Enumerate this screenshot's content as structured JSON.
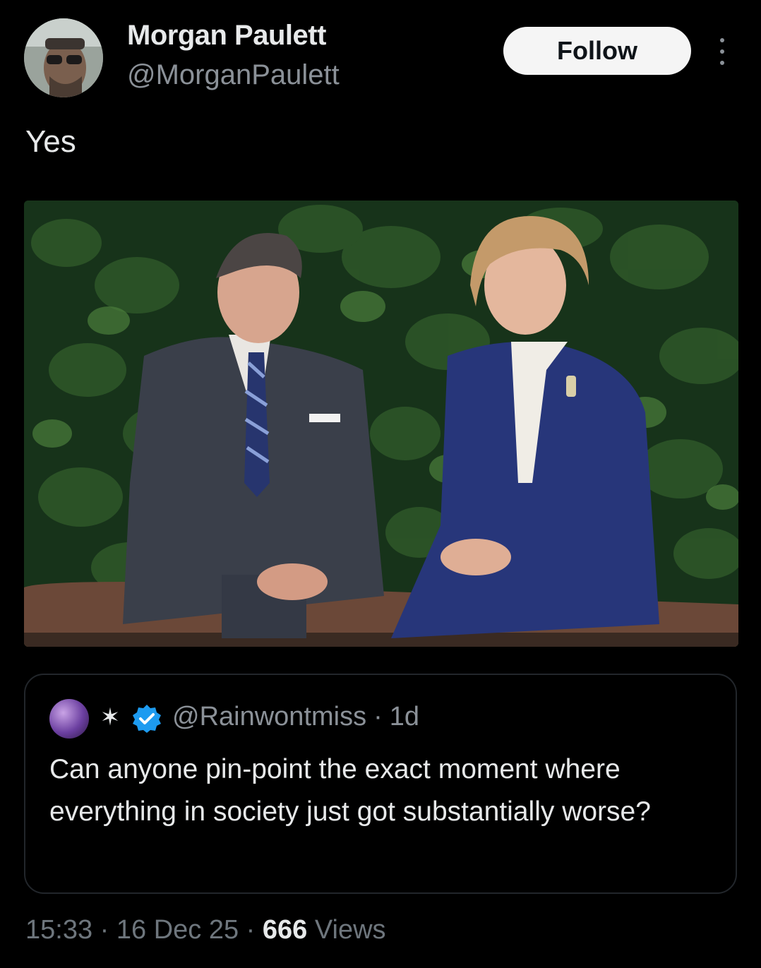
{
  "author": {
    "name": "Morgan Paulett",
    "handle": "@MorganPaulett"
  },
  "follow_label": "Follow",
  "more_icon": "more-vertical-icon",
  "tweet_text": "Yes",
  "quoted_tweet": {
    "handle": "@Rainwontmiss",
    "age": "1d",
    "text": "Can anyone pin-point the exact moment where everything in society just got substantially worse?",
    "verified_color": "#1d9bf0"
  },
  "meta": {
    "time": "15:33",
    "date": "16 Dec 25",
    "views_count": "666",
    "views_label": "Views"
  },
  "colors": {
    "background": "#000000",
    "text_primary": "#e7e9ea",
    "text_secondary": "#8b9198",
    "follow_bg": "#f5f5f5"
  }
}
